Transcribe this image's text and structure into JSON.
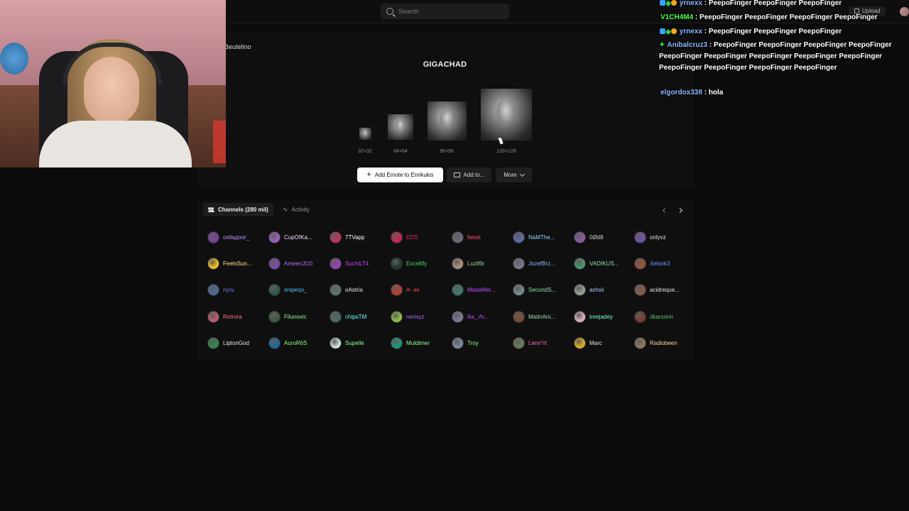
{
  "topbar": {
    "search_placeholder": "Search",
    "upload_label": "Upload"
  },
  "emote": {
    "owner": "Beutelino",
    "name": "GIGACHAD",
    "sizes": [
      {
        "label": "32×32"
      },
      {
        "label": "64×64"
      },
      {
        "label": "96×96"
      },
      {
        "label": "128×128"
      }
    ],
    "actions": {
      "add_label": "Add Emote to Emikukis",
      "add_to_label": "Add to...",
      "more_label": "More"
    }
  },
  "channels_panel": {
    "tabs": [
      {
        "label": "Channels (280 mil)",
        "icon": "users-icon",
        "active": true
      },
      {
        "label": "Activity",
        "icon": "activity-icon",
        "active": false
      }
    ],
    "rows": [
      [
        {
          "name": "ceilaдoor_",
          "color": "#b892ff",
          "avatar": "#7a3fa0"
        },
        {
          "name": "CupOfKa...",
          "color": "#f0d8ff",
          "avatar": "#a060c0"
        },
        {
          "name": "7TVapp",
          "color": "#ffffff",
          "avatar": "#c8305a"
        },
        {
          "name": "EDS",
          "color": "#e0206a",
          "avatar": "#d02050"
        },
        {
          "name": "fwost",
          "color": "#ff4f7a",
          "avatar": "#6a6a7a"
        },
        {
          "name": "NaMThe...",
          "color": "#8ed8ff",
          "avatar": "#5a6aaa"
        },
        {
          "name": "0Ød8",
          "color": "#d0d0d0",
          "avatar": "#8a5aa0"
        },
        {
          "name": "onlyvz",
          "color": "#e6e6e6",
          "avatar": "#7050b0"
        }
      ],
      [
        {
          "name": "FeelsSun...",
          "color": "#ffe58a",
          "avatar": "#f0c020"
        },
        {
          "name": "AmeenJI10",
          "color": "#b070ff",
          "avatar": "#7a4ab0"
        },
        {
          "name": "SuchiLT4",
          "color": "#d040ff",
          "avatar": "#9a40c0"
        },
        {
          "name": "Excellify",
          "color": "#4fd070",
          "avatar": "#1a3a2a"
        },
        {
          "name": "Luzif6r",
          "color": "#a0d8a0",
          "avatar": "#b09080"
        },
        {
          "name": "JozefBrz...",
          "color": "#8ab8ff",
          "avatar": "#7a7a8a"
        },
        {
          "name": "VADIKUS...",
          "color": "#8ee0b0",
          "avatar": "#4a9a6a"
        },
        {
          "name": "Xelsnk3",
          "color": "#6aa0ff",
          "avatar": "#a05030"
        }
      ],
      [
        {
          "name": "nyru",
          "color": "#7a7aff",
          "avatar": "#4a6aa0"
        },
        {
          "name": "sniperpi_",
          "color": "#4fc0ff",
          "avatar": "#2a5a4a"
        },
        {
          "name": "oAstria",
          "color": "#e6e6e6",
          "avatar": "#5a7a6a"
        },
        {
          "name": "A· ev",
          "color": "#ff5050",
          "avatar": "#c03a30"
        },
        {
          "name": "MadaMel...",
          "color": "#c050ff",
          "avatar": "#3a7a6a"
        },
        {
          "name": "SecondS...",
          "color": "#8ee0b0",
          "avatar": "#7a8a8a"
        },
        {
          "name": "ashsii",
          "color": "#b0c8ff",
          "avatar": "#9aa09a"
        },
        {
          "name": "acidreque...",
          "color": "#e6e6e6",
          "avatar": "#8a5a4a"
        }
      ],
      [
        {
          "name": "Retrora",
          "color": "#ff7a8a",
          "avatar": "#c05a6a"
        },
        {
          "name": "Filunovic",
          "color": "#8eff8e",
          "avatar": "#3a5a3a"
        },
        {
          "name": "chipsTM",
          "color": "#6affff",
          "avatar": "#4a6a6a"
        },
        {
          "name": "nerixyz",
          "color": "#b070ff",
          "avatar": "#90c040"
        },
        {
          "name": "ilia_ Ar...",
          "color": "#b050ff",
          "avatar": "#7a7a9a"
        },
        {
          "name": "MatinAni...",
          "color": "#8ee0b0",
          "avatar": "#7a4a2a"
        },
        {
          "name": "treejadey",
          "color": "#7affd0",
          "avatar": "#e0b0c0"
        },
        {
          "name": "dkarsonn",
          "color": "#4fd070",
          "avatar": "#7a3a2a"
        }
      ],
      [
        {
          "name": "LiptonGod",
          "color": "#e6e6e6",
          "avatar": "#2a8a4a"
        },
        {
          "name": "AuroR6S",
          "color": "#8eff8e",
          "avatar": "#1a6aa0"
        },
        {
          "name": "Supelle",
          "color": "#8eff8e",
          "avatar": "#d0e0e0"
        },
        {
          "name": "Muldimer",
          "color": "#8eff8e",
          "avatar": "#1a9a7a"
        },
        {
          "name": "Troy",
          "color": "#8eff8e",
          "avatar": "#7a8aa0"
        },
        {
          "name": "Lenn°rt",
          "color": "#ff70c0",
          "avatar": "#6a7a5a"
        },
        {
          "name": "Marc",
          "color": "#e6e6e6",
          "avatar": "#e0b020"
        },
        {
          "name": "Radiobeen",
          "color": "#ffd0a0",
          "avatar": "#8a7a5a"
        }
      ]
    ]
  },
  "chat": {
    "messages": [
      {
        "user": "yrnexx",
        "user_color": "#8ab8ff",
        "text": "PeepoFinger PeepoFinger PeepoFinger",
        "badges": [
          "blue",
          "green",
          "gold"
        ]
      },
      {
        "user": "V1CH4M4",
        "user_color": "#4fff4f",
        "text": "PeepoFinger PeepoFinger PeepoFinger PeepoFinger",
        "badges": []
      },
      {
        "user": "yrnexx",
        "user_color": "#8ab8ff",
        "text": "PeepoFinger PeepoFinger PeepoFinger",
        "badges": [
          "blue",
          "green",
          "gold"
        ]
      },
      {
        "user": "Anibalcruz3",
        "user_color": "#8ab8ff",
        "text": "PeepoFinger PeepoFinger PeepoFinger PeepoFinger PeepoFinger PeepoFinger PeepoFinger PeepoFinger PeepoFinger PeepoFinger PeepoFinger PeepoFinger PeepoFinger",
        "badges": [
          "star"
        ]
      },
      {
        "user": "elgordox338",
        "user_color": "#8ab8ff",
        "text": "hola",
        "badges": []
      }
    ]
  }
}
